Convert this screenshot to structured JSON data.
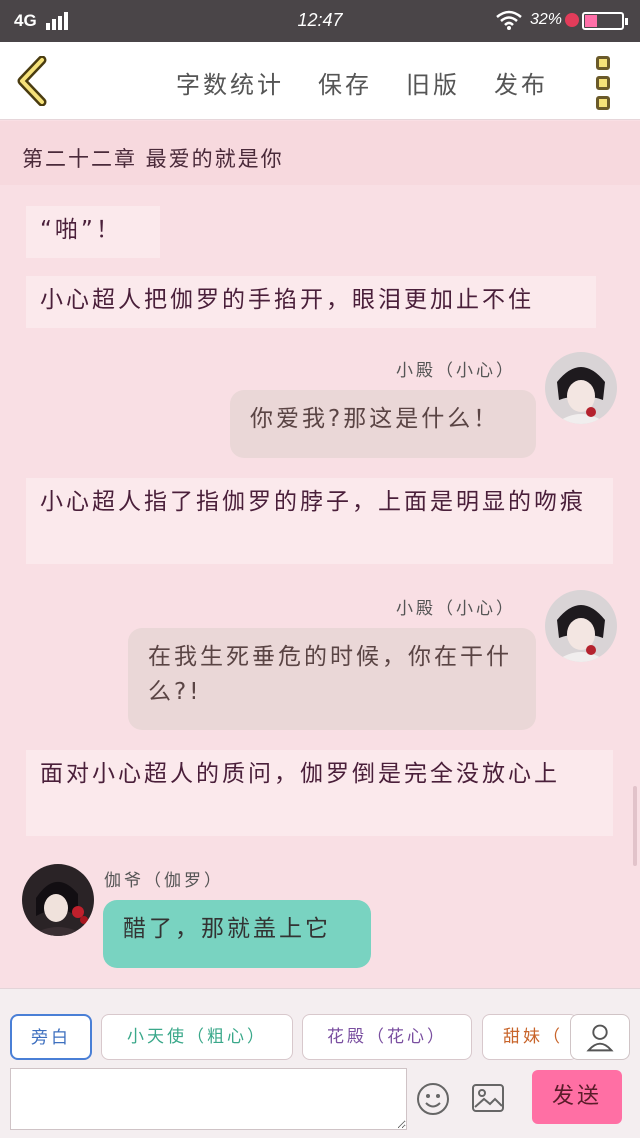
{
  "status_bar": {
    "network": "4G",
    "time": "12:47",
    "battery_percent": "32%",
    "battery_level": 0.32,
    "signal_icon": "signal-bars-icon",
    "wifi_icon": "wifi-icon"
  },
  "header": {
    "back_icon": "chevron-left-icon",
    "nav": [
      "字数统计",
      "保存",
      "旧版",
      "发布"
    ],
    "menu_icon": "more-vertical-icon"
  },
  "chapter_title": "第二十二章 最爱的就是你",
  "messages": [
    {
      "type": "narration",
      "text": "“啪”！"
    },
    {
      "type": "narration",
      "text": "小心超人把伽罗的手掐开，眼泪更加止不住"
    },
    {
      "type": "chat",
      "side": "right",
      "speaker": "小殿（小心）",
      "text": "你爱我?那这是什么！"
    },
    {
      "type": "narration",
      "text": "小心超人指了指伽罗的脖子，上面是明显的吻痕"
    },
    {
      "type": "chat",
      "side": "right",
      "speaker": "小殿（小心）",
      "text": "在我生死垂危的时候，你在干什么?!"
    },
    {
      "type": "narration",
      "text": "面对小心超人的质问，伽罗倒是完全没放心上"
    },
    {
      "type": "chat",
      "side": "left",
      "speaker": "伽爷（伽罗）",
      "text": "醋了，那就盖上它"
    }
  ],
  "roles": [
    "旁白",
    "小天使（粗心）",
    "花殿（花心）",
    "甜妹（"
  ],
  "role_colors": [
    "#3d6fbf",
    "#3aa88a",
    "#7a4fa0",
    "#c8642a"
  ],
  "input": {
    "placeholder": "",
    "value": ""
  },
  "icons": {
    "user": "user-icon",
    "emoji": "smiley-icon",
    "image": "image-icon"
  },
  "send_label": "发送",
  "colors": {
    "accent_pink": "#ff6fa4",
    "chat_left": "#79d3c1",
    "chat_right": "#ead7d7",
    "page_bg": "#f9dfe4"
  }
}
